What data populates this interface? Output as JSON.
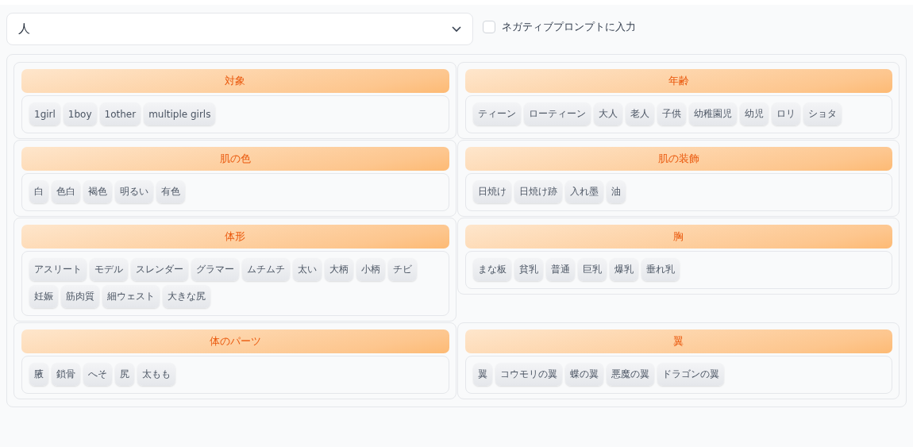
{
  "category_select": {
    "value": "人"
  },
  "negative_prompt": {
    "label": "ネガティブプロンプトに入力",
    "checked": false
  },
  "groups": [
    {
      "title": "対象",
      "tags": [
        "1girl",
        "1boy",
        "1other",
        "multiple girls"
      ]
    },
    {
      "title": "年齢",
      "tags": [
        "ティーン",
        "ローティーン",
        "大人",
        "老人",
        "子供",
        "幼稚園児",
        "幼児",
        "ロリ",
        "ショタ"
      ]
    },
    {
      "title": "肌の色",
      "tags": [
        "白",
        "色白",
        "褐色",
        "明るい",
        "有色"
      ]
    },
    {
      "title": "肌の装飾",
      "tags": [
        "日焼け",
        "日焼け跡",
        "入れ墨",
        "油"
      ]
    },
    {
      "title": "体形",
      "tags": [
        "アスリート",
        "モデル",
        "スレンダー",
        "グラマー",
        "ムチムチ",
        "太い",
        "大柄",
        "小柄",
        "チビ",
        "妊娠",
        "筋肉質",
        "細ウェスト",
        "大きな尻"
      ]
    },
    {
      "title": "胸",
      "tags": [
        "まな板",
        "貧乳",
        "普通",
        "巨乳",
        "爆乳",
        "垂れ乳"
      ]
    },
    {
      "title": "体のパーツ",
      "tags": [
        "腋",
        "鎖骨",
        "へそ",
        "尻",
        "太もも"
      ]
    },
    {
      "title": "翼",
      "tags": [
        "翼",
        "コウモリの翼",
        "蝶の翼",
        "悪魔の翼",
        "ドラゴンの翼"
      ]
    }
  ]
}
